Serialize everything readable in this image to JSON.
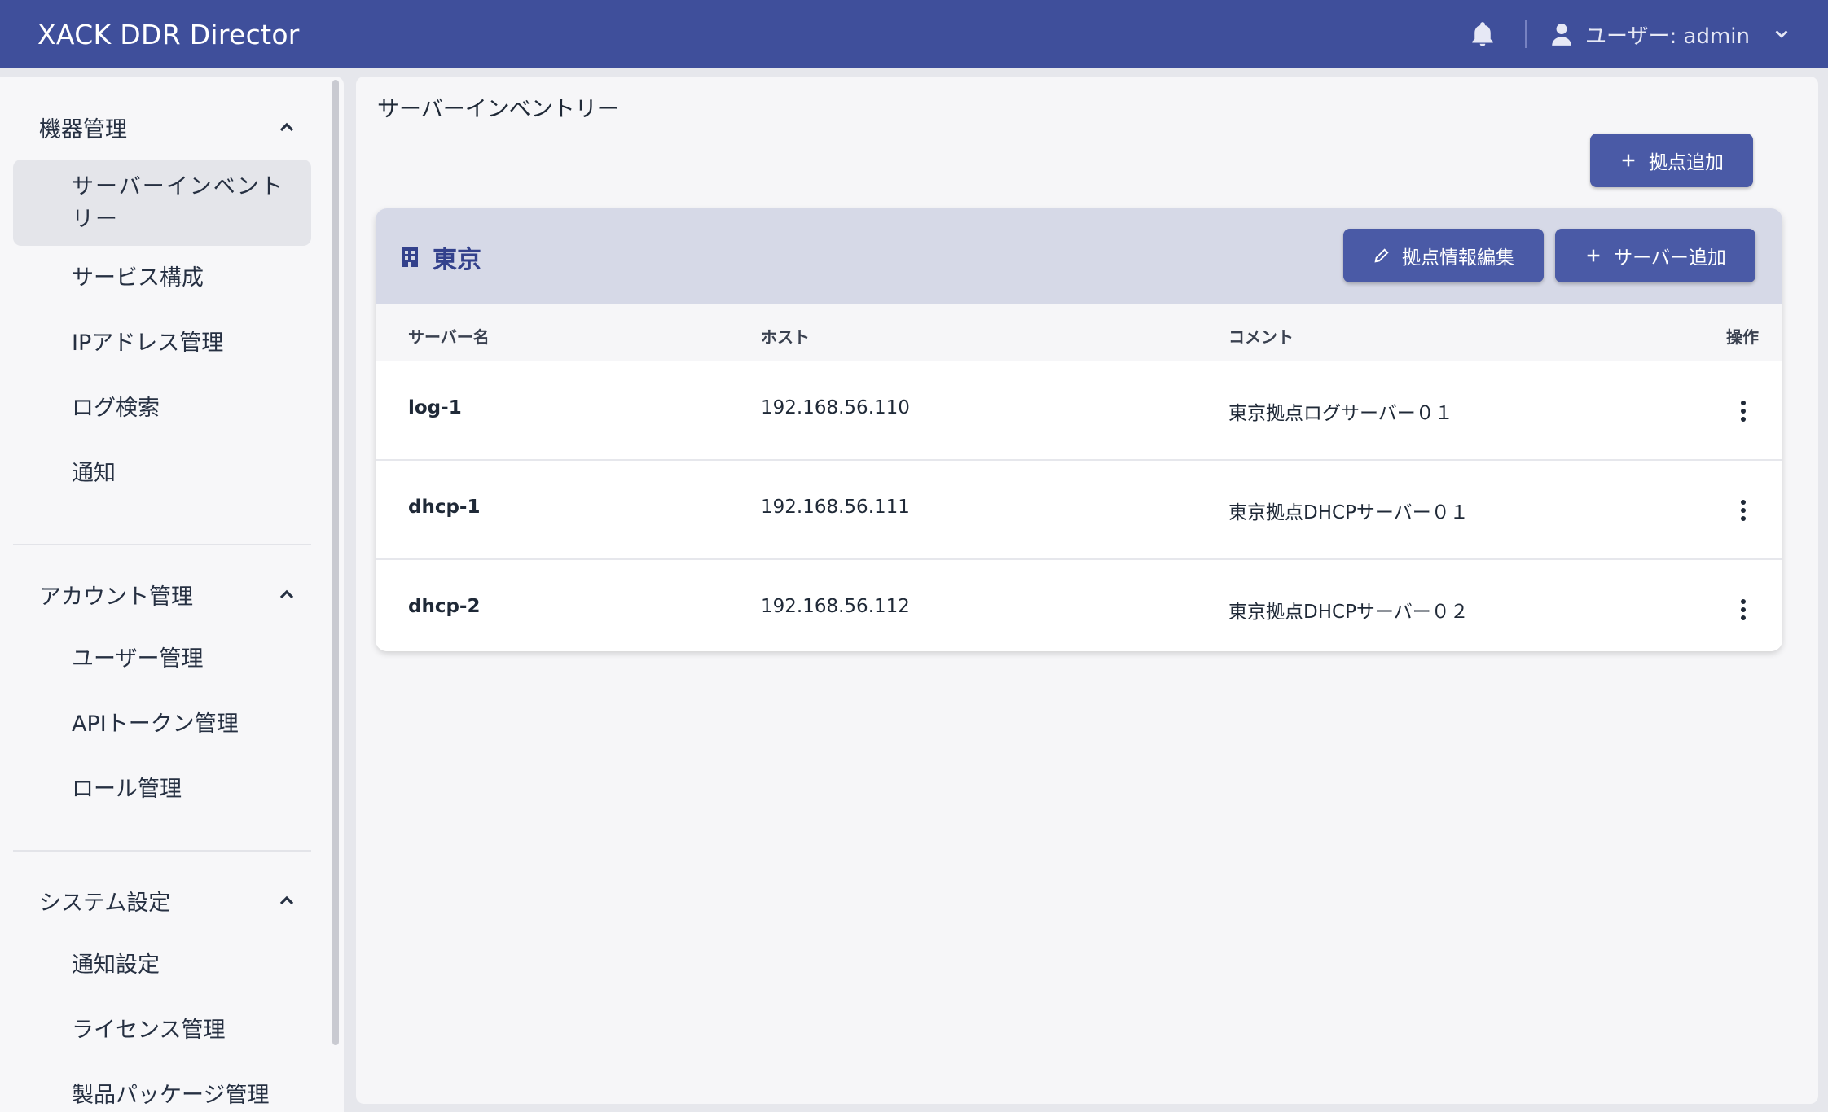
{
  "header": {
    "app_title": "XACK DDR Director",
    "user_label": "ユーザー: admin",
    "icons": [
      "bell-icon",
      "user-icon",
      "chevron-down-icon"
    ]
  },
  "sidebar": {
    "groups": [
      {
        "title": "機器管理",
        "items": [
          {
            "label": "サーバーインベントリー",
            "active": true
          },
          {
            "label": "サービス構成"
          },
          {
            "label": "IPアドレス管理"
          },
          {
            "label": "ログ検索"
          },
          {
            "label": "通知"
          }
        ]
      },
      {
        "title": "アカウント管理",
        "items": [
          {
            "label": "ユーザー管理"
          },
          {
            "label": "APIトークン管理"
          },
          {
            "label": "ロール管理"
          }
        ]
      },
      {
        "title": "システム設定",
        "items": [
          {
            "label": "通知設定"
          },
          {
            "label": "ライセンス管理"
          },
          {
            "label": "製品パッケージ管理"
          }
        ]
      }
    ]
  },
  "main": {
    "page_title": "サーバーインベントリー",
    "add_site_label": "拠点追加",
    "site": {
      "name": "東京",
      "edit_label": "拠点情報編集",
      "add_server_label": "サーバー追加",
      "columns": [
        "サーバー名",
        "ホスト",
        "コメント",
        "操作"
      ],
      "rows": [
        {
          "name": "log-1",
          "host": "192.168.56.110",
          "comment": "東京拠点ログサーバー０１"
        },
        {
          "name": "dhcp-1",
          "host": "192.168.56.111",
          "comment": "東京拠点DHCPサーバー０１"
        },
        {
          "name": "dhcp-2",
          "host": "192.168.56.112",
          "comment": "東京拠点DHCPサーバー０２"
        }
      ]
    }
  },
  "colors": {
    "header_bg": "#3f4f9b",
    "primary_button": "#4a5aa6",
    "site_header_bg": "#d6d9e7",
    "site_name": "#33418c"
  }
}
